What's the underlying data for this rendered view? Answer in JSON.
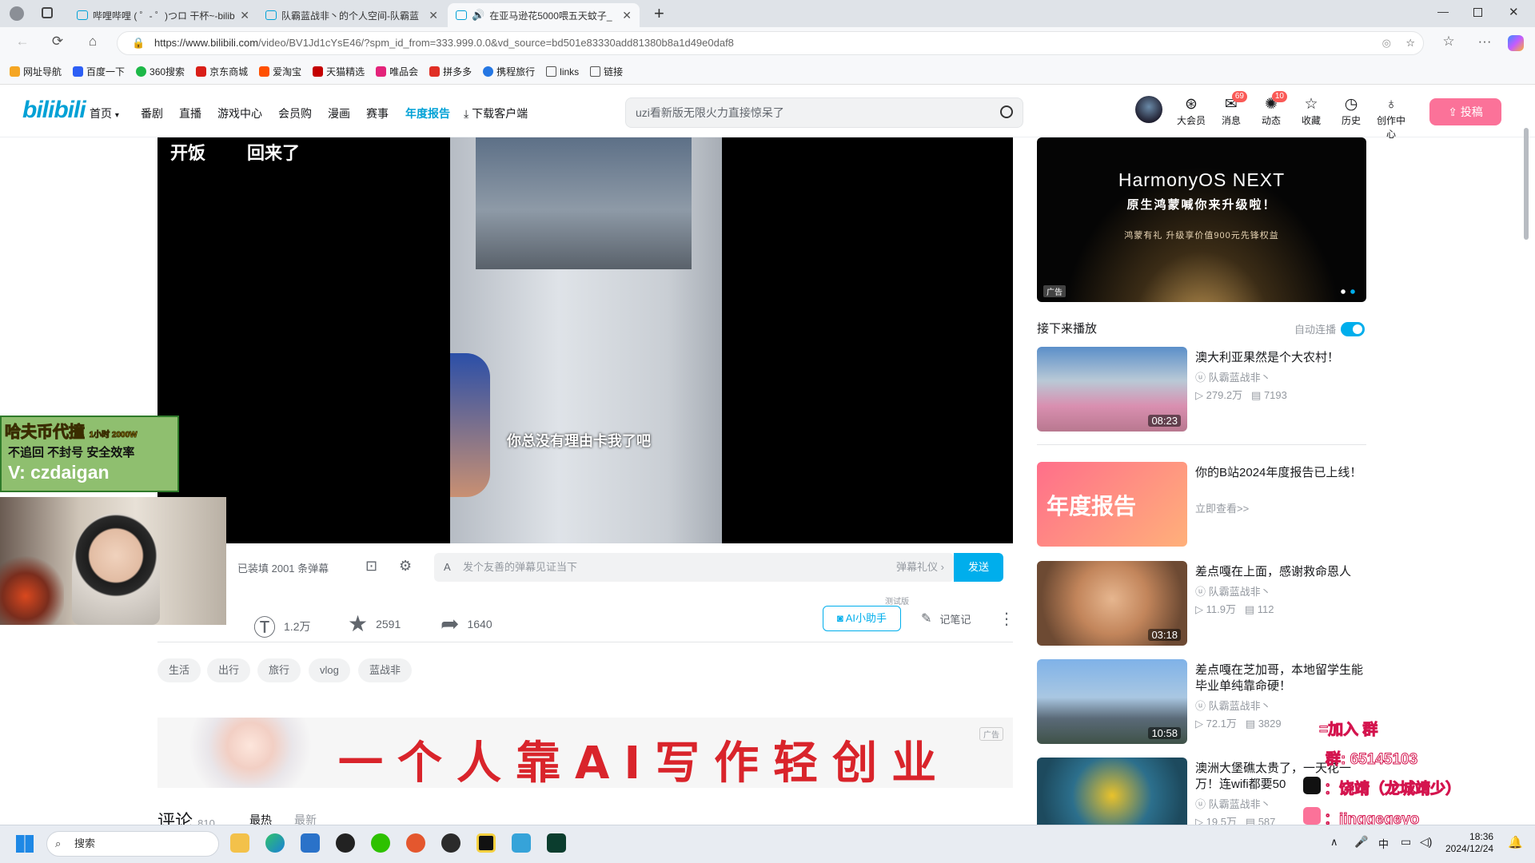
{
  "browser": {
    "tabs": [
      {
        "label": "哔哩哔哩 ( ゜- ゜)つロ 干杯~-bilib"
      },
      {
        "label": "队霸蓝战非丶的个人空间-队霸蓝"
      },
      {
        "label": "在亚马逊花5000喂五天蚊子_"
      }
    ],
    "url_host": "https://www.bilibili.com",
    "url_path": "/video/BV1Jd1cYsE46/?spm_id_from=333.999.0.0&vd_source=bd501e83330add81380b8a1d49e0daf8",
    "bookmarks": [
      "网址导航",
      "百度一下",
      "360搜索",
      "京东商城",
      "爱淘宝",
      "天猫精选",
      "唯品会",
      "拼多多",
      "携程旅行",
      "links",
      "链接"
    ]
  },
  "header": {
    "logo": "bilibili",
    "nav": [
      "首页",
      "番剧",
      "直播",
      "游戏中心",
      "会员购",
      "漫画",
      "赛事",
      "年度报告",
      "下载客户端"
    ],
    "search_placeholder": "uzi看新版无限火力直接惊呆了",
    "user_menu": [
      {
        "label": "大会员",
        "badge": ""
      },
      {
        "label": "消息",
        "badge": "69"
      },
      {
        "label": "动态",
        "badge": "10"
      },
      {
        "label": "收藏",
        "badge": ""
      },
      {
        "label": "历史",
        "badge": ""
      },
      {
        "label": "创作中心",
        "badge": ""
      }
    ],
    "upload_label": "投稿"
  },
  "video": {
    "subtitle_top_left": "开饭",
    "subtitle_top_right": "回来了",
    "subtitle_center": "你总没有理由卡我了吧"
  },
  "danmaku": {
    "count_text": "已装填 2001 条弹幕",
    "input_placeholder": "发个友善的弹幕见证当下",
    "etiquette": "弹幕礼仪 ›",
    "send_label": "发送"
  },
  "actions": {
    "coin": "1.2万",
    "favorite": "2591",
    "share": "1640",
    "ai_label": "AI小助手",
    "ai_badge": "测试版",
    "notes_label": "记笔记"
  },
  "tags": [
    "生活",
    "出行",
    "旅行",
    "vlog",
    "蓝战非"
  ],
  "ad_banner": {
    "text": "一个人靠AI写作轻创业",
    "badge": "广告"
  },
  "comments": {
    "title": "评论",
    "count": "810",
    "sort_hot": "最热",
    "sort_new": "最新"
  },
  "sidebar": {
    "ad": {
      "headline": "HarmonyOS NEXT",
      "sub": "原生鸿蒙喊你来升级啦！",
      "small": "鸿蒙有礼 升级享价值900元先锋权益",
      "badge": "广告"
    },
    "next_title": "接下来播放",
    "autoplay_label": "自动连播",
    "items": [
      {
        "title": "澳大利亚果然是个大农村！",
        "up": "队霸蓝战非丶",
        "views": "279.2万",
        "danmaku": "7193",
        "duration": "08:23"
      },
      {
        "title": "你的B站2024年度报告已上线！",
        "up": "立即查看>>",
        "views": "",
        "danmaku": "",
        "duration": "",
        "thumb_text": "年度报告"
      },
      {
        "title": "差点嘎在上面，感谢救命恩人",
        "up": "队霸蓝战非丶",
        "views": "11.9万",
        "danmaku": "112",
        "duration": "03:18"
      },
      {
        "title": "差点嘎在芝加哥，本地留学生能毕业单纯靠命硬！",
        "up": "队霸蓝战非丶",
        "views": "72.1万",
        "danmaku": "3829",
        "duration": "10:58"
      },
      {
        "title": "澳洲大堡礁太贵了，一天花一万！连wifi都要50",
        "up": "队霸蓝战非丶",
        "views": "19.5万",
        "danmaku": "587",
        "duration": ""
      }
    ]
  },
  "stream_overlay": {
    "promo_line1": "哈夫币代撞",
    "promo_line1_small": "1小时 2000W",
    "promo_line2": "不追回 不封号 安全效率",
    "promo_line3": "V: czdaigan",
    "join_group": "=加入 群",
    "qq": "群: 65145103",
    "douyin": "：饶靖（龙城靖少）",
    "bili": "：jinggegeyo"
  },
  "taskbar": {
    "search_label": "搜索",
    "ime": "中",
    "time": "18:36",
    "date": "2024/12/24"
  }
}
